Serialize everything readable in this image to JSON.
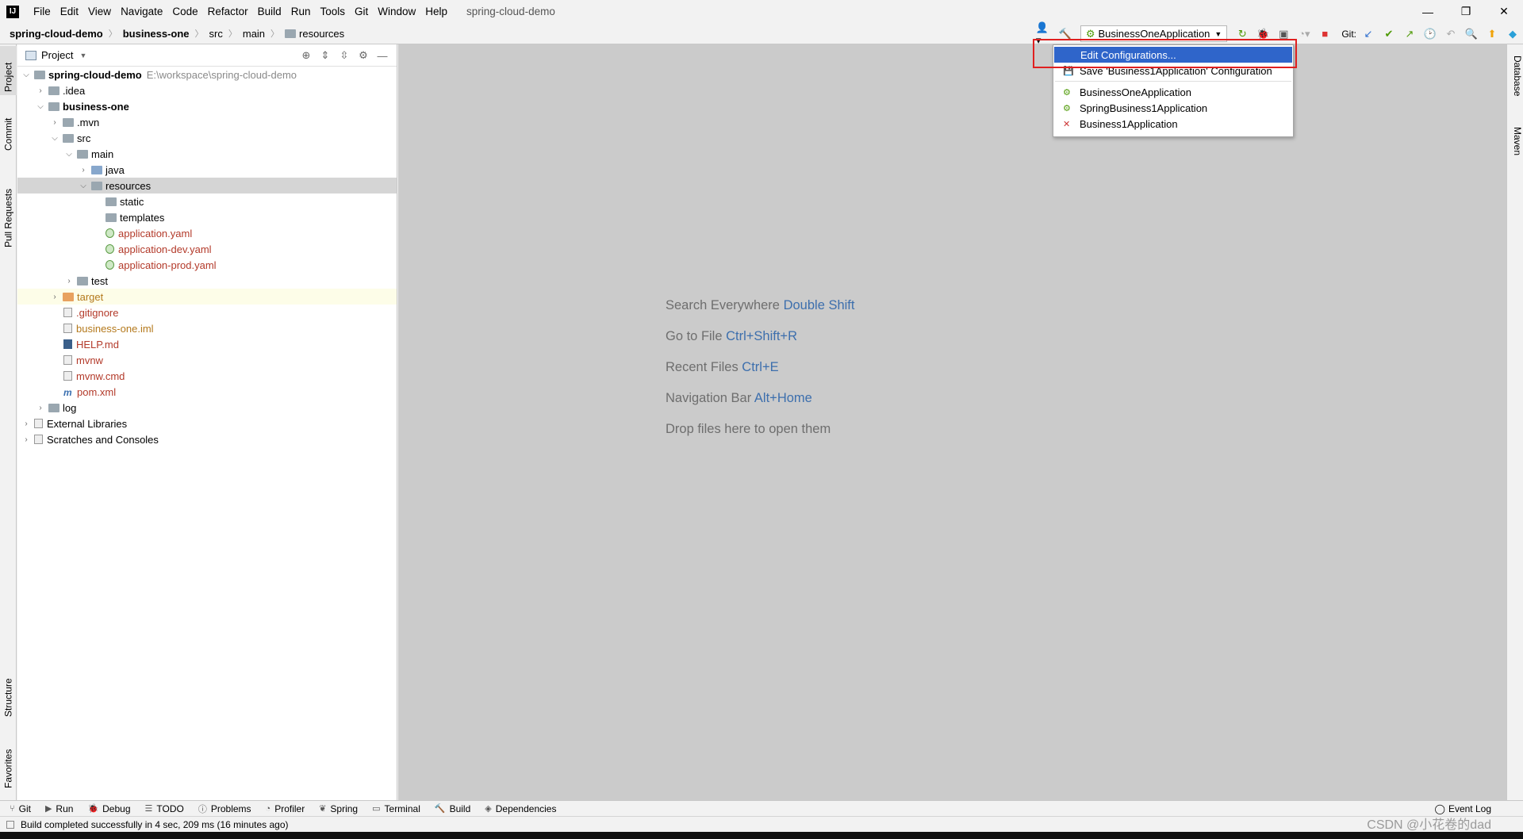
{
  "app": {
    "logo": "IJ",
    "project_title": "spring-cloud-demo"
  },
  "menu": [
    "File",
    "Edit",
    "View",
    "Navigate",
    "Code",
    "Refactor",
    "Build",
    "Run",
    "Tools",
    "Git",
    "Window",
    "Help"
  ],
  "window_controls": {
    "minimize": "—",
    "restore": "❐",
    "close": "✕"
  },
  "breadcrumb": [
    "spring-cloud-demo",
    "business-one",
    "src",
    "main",
    "resources"
  ],
  "toolbar": {
    "run_config": "BusinessOneApplication",
    "git_label": "Git:"
  },
  "left_tabs": {
    "project": "Project",
    "commit": "Commit",
    "pull_requests": "Pull Requests",
    "structure": "Structure",
    "favorites": "Favorites"
  },
  "right_tabs": {
    "database": "Database",
    "maven": "Maven"
  },
  "project_panel": {
    "title": "Project"
  },
  "tree": [
    {
      "label": "spring-cloud-demo",
      "path": "E:\\workspace\\spring-cloud-demo"
    },
    {
      "label": ".idea"
    },
    {
      "label": "business-one"
    },
    {
      "label": ".mvn"
    },
    {
      "label": "src"
    },
    {
      "label": "main"
    },
    {
      "label": "java"
    },
    {
      "label": "resources"
    },
    {
      "label": "static"
    },
    {
      "label": "templates"
    },
    {
      "label": "application.yaml"
    },
    {
      "label": "application-dev.yaml"
    },
    {
      "label": "application-prod.yaml"
    },
    {
      "label": "test"
    },
    {
      "label": "target"
    },
    {
      "label": ".gitignore"
    },
    {
      "label": "business-one.iml"
    },
    {
      "label": "HELP.md"
    },
    {
      "label": "mvnw"
    },
    {
      "label": "mvnw.cmd"
    },
    {
      "label": "pom.xml"
    },
    {
      "label": "log"
    },
    {
      "label": "External Libraries"
    },
    {
      "label": "Scratches and Consoles"
    }
  ],
  "editor_hints": [
    {
      "text": "Search Everywhere",
      "key": "Double Shift"
    },
    {
      "text": "Go to File",
      "key": "Ctrl+Shift+R"
    },
    {
      "text": "Recent Files",
      "key": "Ctrl+E"
    },
    {
      "text": "Navigation Bar",
      "key": "Alt+Home"
    },
    {
      "text": "Drop files here to open them",
      "key": ""
    }
  ],
  "popup": {
    "items": [
      "Edit Configurations...",
      "Save 'Business1Application' Configuration",
      "BusinessOneApplication",
      "SpringBusiness1Application",
      "Business1Application"
    ]
  },
  "bottom_tabs": [
    "Git",
    "Run",
    "Debug",
    "TODO",
    "Problems",
    "Profiler",
    "Spring",
    "Terminal",
    "Build",
    "Dependencies"
  ],
  "event_log": "Event Log",
  "status": "Build completed successfully in 4 sec, 209 ms (16 minutes ago)",
  "watermark": "CSDN @小花卷的dad",
  "colors": {
    "accent": "#2f65ca",
    "highlight_box": "#e02020",
    "editor_bg": "#cbcbcb",
    "key_blue": "#3d6fad"
  }
}
